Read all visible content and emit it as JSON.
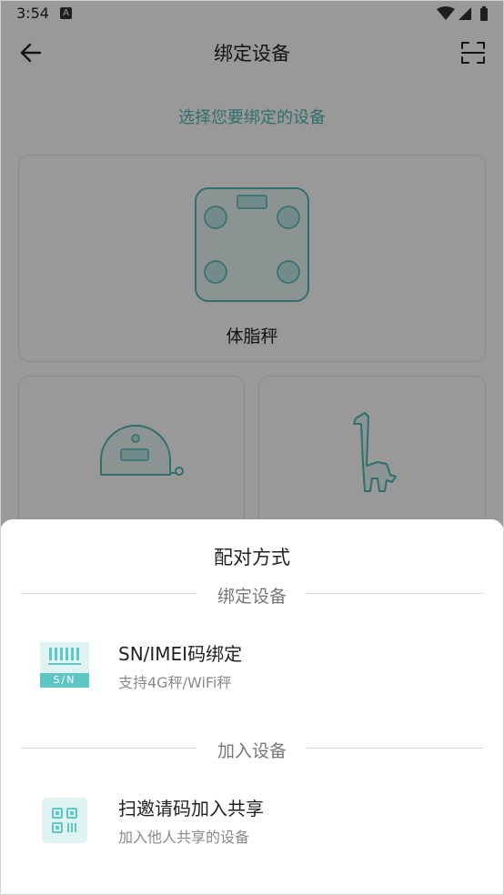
{
  "status_bar": {
    "time": "3:54",
    "notification_badge": "A"
  },
  "header": {
    "title": "绑定设备"
  },
  "subtitle": "选择您要绑定的设备",
  "devices": [
    {
      "label": "体脂秤",
      "icon": "body-fat-scale-icon"
    },
    {
      "label": "",
      "icon": "tape-measure-device-icon"
    },
    {
      "label": "",
      "icon": "giraffe-height-ruler-icon"
    }
  ],
  "sheet": {
    "title": "配对方式",
    "bind_section": {
      "label": "绑定设备",
      "option": {
        "title": "SN/IMEI码绑定",
        "subtitle": "支持4G秤/WiFi秤",
        "icon_text": "S/N",
        "icon": "sn-barcode-icon"
      }
    },
    "join_section": {
      "label": "加入设备",
      "option": {
        "title": "扫邀请码加入共享",
        "subtitle": "加入他人共享的设备",
        "icon": "qr-code-icon"
      }
    }
  },
  "colors": {
    "accent": "#4fbab5",
    "icon_bg": "#5fc6c6",
    "icon_bg_light": "#dff3f3"
  }
}
